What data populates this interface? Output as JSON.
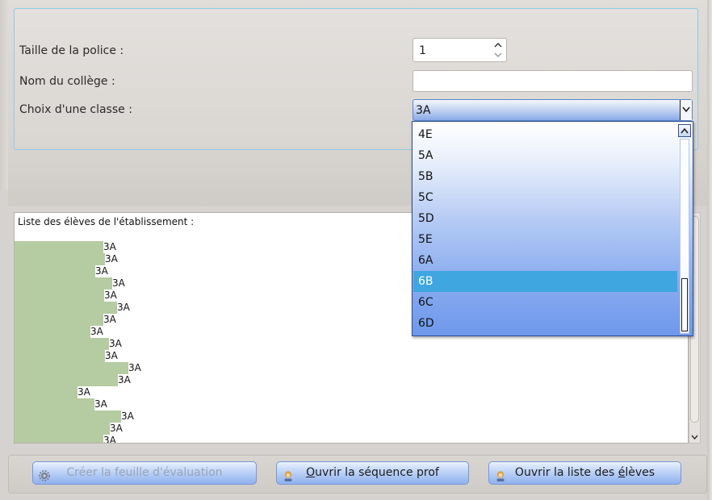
{
  "form": {
    "font_size_label": "Taille de la police :",
    "font_size_value": "1",
    "college_label": "Nom du collège :",
    "college_value": "",
    "class_label": "Choix d'une classe :",
    "class_selected": "3A"
  },
  "dropdown": {
    "options": [
      "4E",
      "5A",
      "5B",
      "5C",
      "5D",
      "5E",
      "6A",
      "6B",
      "6C",
      "6D"
    ],
    "highlighted": "6B"
  },
  "students": {
    "title": "Liste des élèves de l'établissement :",
    "rows": [
      {
        "label": "3A",
        "level": 110
      },
      {
        "label": "3A",
        "level": 112
      },
      {
        "label": "3A",
        "level": 100
      },
      {
        "label": "3A",
        "level": 121
      },
      {
        "label": "3A",
        "level": 111
      },
      {
        "label": "3A",
        "level": 127
      },
      {
        "label": "3A",
        "level": 110
      },
      {
        "label": "3A",
        "level": 94
      },
      {
        "label": "3A",
        "level": 117
      },
      {
        "label": "3A",
        "level": 112
      },
      {
        "label": "3A",
        "level": 141
      },
      {
        "label": "3A",
        "level": 128
      },
      {
        "label": "3A",
        "level": 78
      },
      {
        "label": "3A",
        "level": 99
      },
      {
        "label": "3A",
        "level": 132
      },
      {
        "label": "3A",
        "level": 118
      },
      {
        "label": "3A",
        "level": 110
      }
    ]
  },
  "buttons": {
    "create_sheet": {
      "text": "Créer la feuille d'évaluation"
    },
    "open_sequence": {
      "pre": "",
      "accel": "O",
      "post": "uvrir la séquence prof"
    },
    "open_students": {
      "pre": "Ouvrir la liste des ",
      "accel": "é",
      "post": "lèves"
    }
  },
  "colors": {
    "bar_fill": "#b5cba1",
    "selection": "#3fa6e0",
    "button_accent": "#8eb1ef"
  }
}
